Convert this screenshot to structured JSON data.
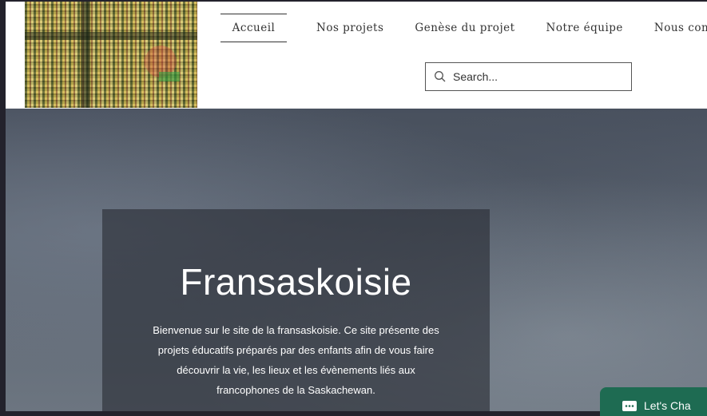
{
  "nav": {
    "items": [
      {
        "label": "Accueil",
        "active": true
      },
      {
        "label": "Nos projets"
      },
      {
        "label": "Genèse du projet"
      },
      {
        "label": "Notre équipe"
      },
      {
        "label": "Nous contacter"
      }
    ]
  },
  "search": {
    "placeholder": "Search...",
    "icon": "search-icon"
  },
  "hero": {
    "title": "Fransaskoisie",
    "description": "Bienvenue sur le site de la fransaskoisie. Ce site présente des projets éducatifs préparés par des enfants afin de vous faire découvrir la vie, les lieux et les évènements liés aux francophones de la Saskachewan."
  },
  "chat": {
    "label": "Let's Cha",
    "icon": "chat-bubble-icon",
    "color": "#1e6b52"
  }
}
